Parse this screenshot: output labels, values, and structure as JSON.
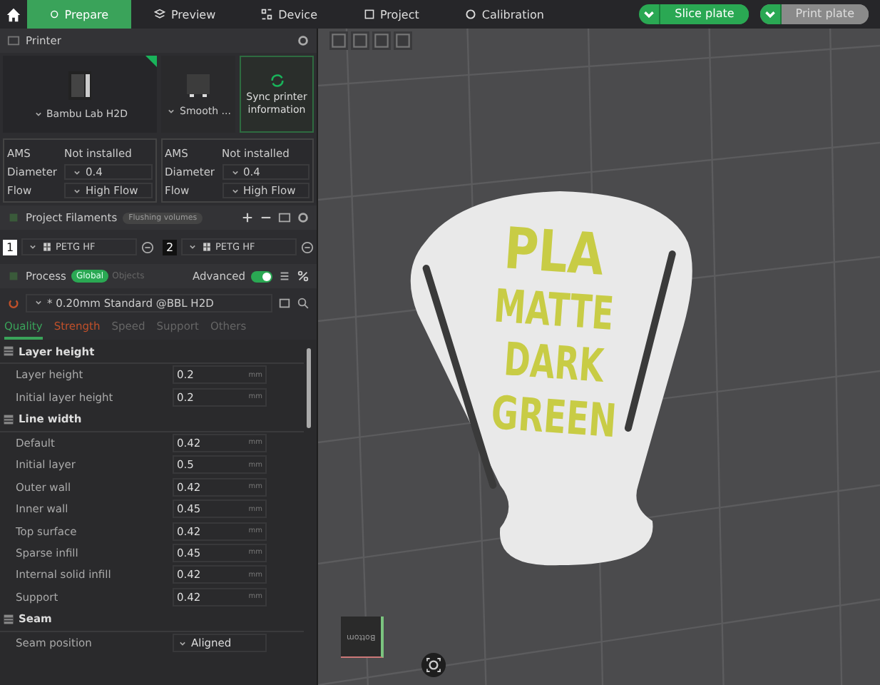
{
  "nav": {
    "tabs": [
      {
        "label": "Prepare",
        "selected": true
      },
      {
        "label": "Preview",
        "selected": false
      },
      {
        "label": "Device",
        "selected": false
      },
      {
        "label": "Project",
        "selected": false
      },
      {
        "label": "Calibration",
        "selected": false
      }
    ],
    "actions": [
      {
        "label": "Slice plate",
        "enabled": true
      },
      {
        "label": "Print plate",
        "enabled": false
      }
    ]
  },
  "printer": {
    "title": "Printer",
    "printer_name": "Bambu Lab H2D",
    "plate_name": "Smooth ...",
    "sync_label": "Sync printer information",
    "nozzles": [
      {
        "ams_label": "AMS",
        "ams_value": "Not installed",
        "diameter_label": "Diameter",
        "diameter": "0.4",
        "flow_label": "Flow",
        "flow": "High Flow"
      },
      {
        "ams_label": "AMS",
        "ams_value": "Not installed",
        "diameter_label": "Diameter",
        "diameter": "0.4",
        "flow_label": "Flow",
        "flow": "High Flow"
      }
    ]
  },
  "filaments": {
    "title": "Project Filaments",
    "flushing_button": "Flushing volumes",
    "items": [
      {
        "index": "1",
        "name": "PETG HF",
        "color": "#ffffff"
      },
      {
        "index": "2",
        "name": "PETG HF",
        "color": "#111111"
      }
    ]
  },
  "process": {
    "title": "Process",
    "scope": [
      {
        "label": "Global",
        "selected": true
      },
      {
        "label": "Objects",
        "selected": false
      }
    ],
    "advanced_label": "Advanced",
    "advanced_on": true,
    "preset": "* 0.20mm Standard @BBL H2D",
    "tabs": [
      {
        "label": "Quality",
        "selected": true,
        "modified": false
      },
      {
        "label": "Strength",
        "selected": false,
        "modified": true
      },
      {
        "label": "Speed",
        "selected": false,
        "modified": false
      },
      {
        "label": "Support",
        "selected": false,
        "modified": false
      },
      {
        "label": "Others",
        "selected": false,
        "modified": false
      }
    ]
  },
  "settings": [
    {
      "title": "Layer height",
      "rows": [
        {
          "kind": "number",
          "label": "Layer height",
          "value": "0.2",
          "unit": "mm"
        },
        {
          "kind": "number",
          "label": "Initial layer height",
          "value": "0.2",
          "unit": "mm"
        }
      ]
    },
    {
      "title": "Line width",
      "rows": [
        {
          "kind": "number",
          "label": "Default",
          "value": "0.42",
          "unit": "mm"
        },
        {
          "kind": "number",
          "label": "Initial layer",
          "value": "0.5",
          "unit": "mm"
        },
        {
          "kind": "number",
          "label": "Outer wall",
          "value": "0.42",
          "unit": "mm"
        },
        {
          "kind": "number",
          "label": "Inner wall",
          "value": "0.45",
          "unit": "mm"
        },
        {
          "kind": "number",
          "label": "Top surface",
          "value": "0.42",
          "unit": "mm"
        },
        {
          "kind": "number",
          "label": "Sparse infill",
          "value": "0.45",
          "unit": "mm"
        },
        {
          "kind": "number",
          "label": "Internal solid infill",
          "value": "0.42",
          "unit": "mm"
        },
        {
          "kind": "number",
          "label": "Support",
          "value": "0.42",
          "unit": "mm"
        }
      ]
    },
    {
      "title": "Seam",
      "rows": [
        {
          "kind": "dropdown",
          "label": "Seam position",
          "value": "Aligned"
        }
      ]
    }
  ],
  "canvas": {
    "model_text": [
      "PLA",
      "MATTE",
      "DARK",
      "GREEN"
    ],
    "view_cube_label": "Bottom"
  }
}
